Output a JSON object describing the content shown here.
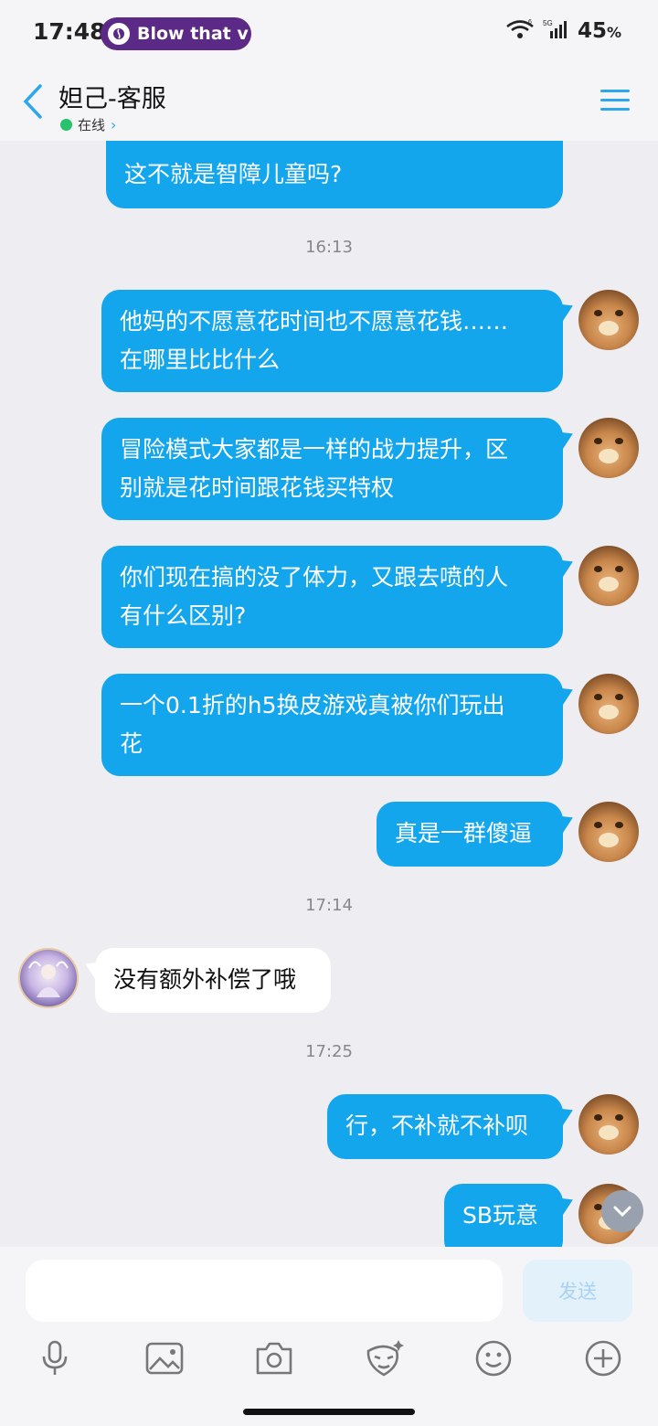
{
  "status_bar": {
    "time": "17:48",
    "notification_pill": "Blow that v",
    "battery": "45",
    "battery_unit": "%",
    "icons": [
      "wifi-icon",
      "signal-5g-icon",
      "signal-bars-icon"
    ]
  },
  "header": {
    "title": "妲己-客服",
    "status": "在线",
    "back_icon": "chevron-left-icon",
    "menu_icon": "menu-icon"
  },
  "messages": [
    {
      "side": "out",
      "text": "这不就是智障儿童吗?"
    },
    {
      "type": "timestamp",
      "text": "16:13"
    },
    {
      "side": "out",
      "lines": [
        "他妈的不愿意花时间也不愿意花钱……",
        "在哪里比比什么"
      ]
    },
    {
      "side": "out",
      "lines": [
        "冒险模式大家都是一样的战力提升，区",
        "别就是花时间跟花钱买特权"
      ]
    },
    {
      "side": "out",
      "lines": [
        "你们现在搞的没了体力，又跟去喷的人",
        "有什么区别?"
      ]
    },
    {
      "side": "out",
      "lines": [
        "一个0.1折的h5换皮游戏真被你们玩出",
        "花"
      ]
    },
    {
      "side": "out",
      "text": "真是一群傻逼"
    },
    {
      "type": "timestamp",
      "text": "17:14"
    },
    {
      "side": "in",
      "text": "没有额外补偿了哦"
    },
    {
      "type": "timestamp",
      "text": "17:25"
    },
    {
      "side": "out",
      "text": "行，不补就不补呗"
    },
    {
      "side": "out",
      "text": "SB玩意"
    }
  ],
  "input": {
    "placeholder": "",
    "send_label": "发送"
  },
  "toolbar": {
    "icons": [
      "microphone-icon",
      "image-icon",
      "camera-icon",
      "sticker-icon",
      "emoji-icon",
      "plus-icon"
    ]
  },
  "colors": {
    "accent": "#13A6EC",
    "online": "#27C26B",
    "pill": "#5B2A86"
  }
}
